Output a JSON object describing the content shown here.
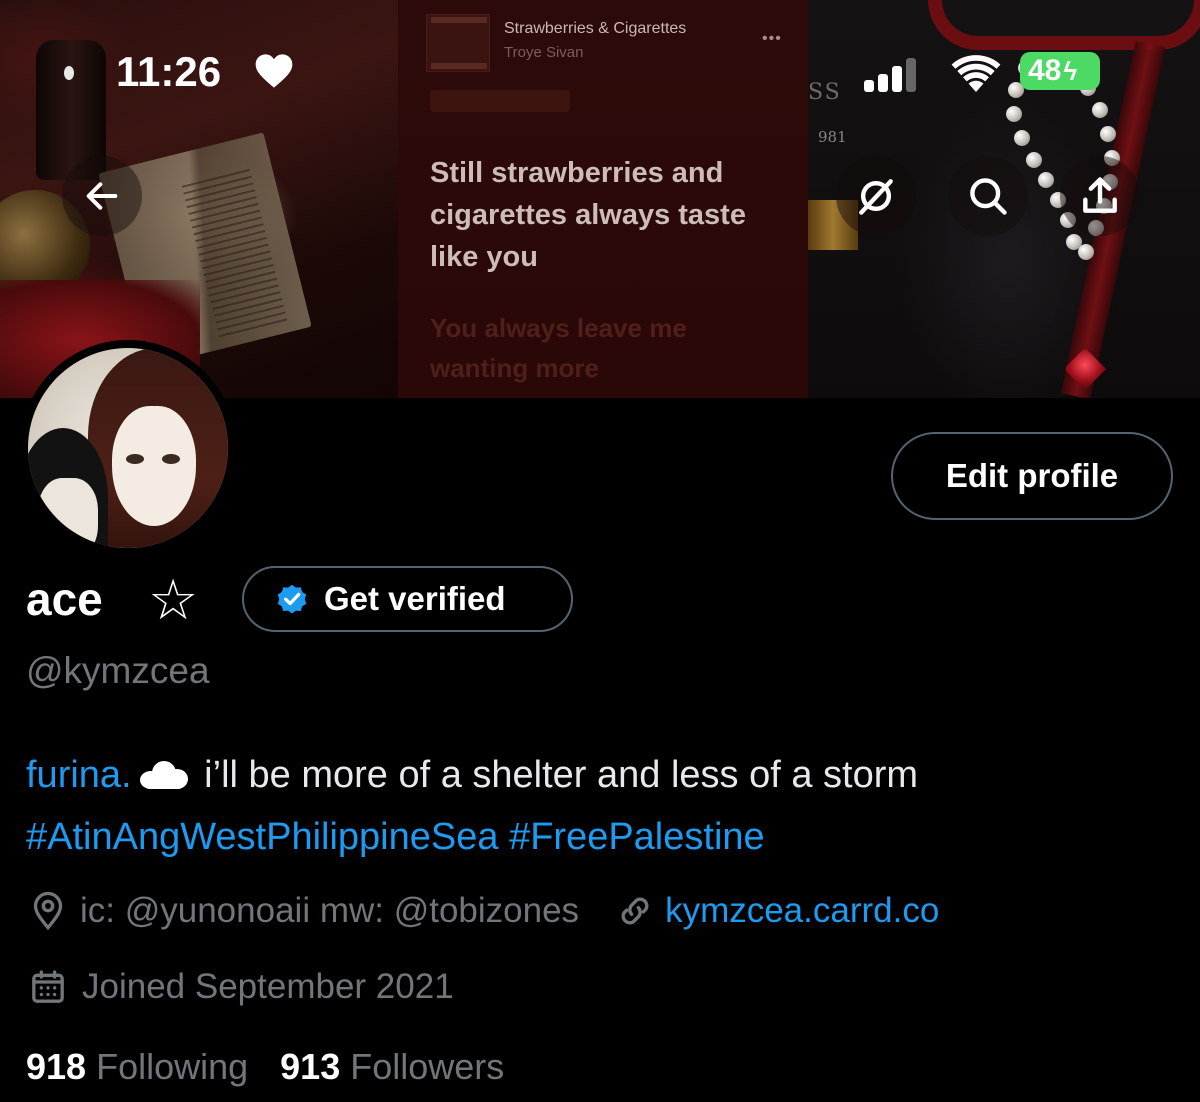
{
  "status_bar": {
    "time": "11:26",
    "battery": "48",
    "battery_color": "#4cd964"
  },
  "banner": {
    "song_title": "Strawberries & Cigarettes",
    "song_artist": "Troye Sivan",
    "more_label": "•••",
    "lyric_current": "Still strawberries and cigarettes always taste like you",
    "lyric_next": "You always leave me wanting more",
    "brand_text": "SS",
    "brand_year": "981"
  },
  "nav": {
    "back_icon": "arrow-left-icon",
    "rss_icon": "rss-off-icon",
    "search_icon": "search-icon",
    "share_icon": "share-icon"
  },
  "profile": {
    "edit_label": "Edit profile",
    "display_name": "ace",
    "name_emoji": "☆",
    "verify_label": "Get verified",
    "handle": "@kymzcea",
    "bio_link": "furina.",
    "bio_text": " i’ll be more of a shelter and less of a storm",
    "hashtags": [
      "#AtinAngWestPhilippineSea",
      "#FreePalestine"
    ],
    "location": "ic: @yunonoaii mw: @tobizones",
    "website": "kymzcea.carrd.co",
    "joined": "Joined September 2021",
    "following_count": "918",
    "following_label": "Following",
    "followers_count": "913",
    "followers_label": "Followers"
  },
  "colors": {
    "accent": "#1d9bf0",
    "muted_text": "#71767b",
    "border": "#536471",
    "background": "#000000"
  }
}
